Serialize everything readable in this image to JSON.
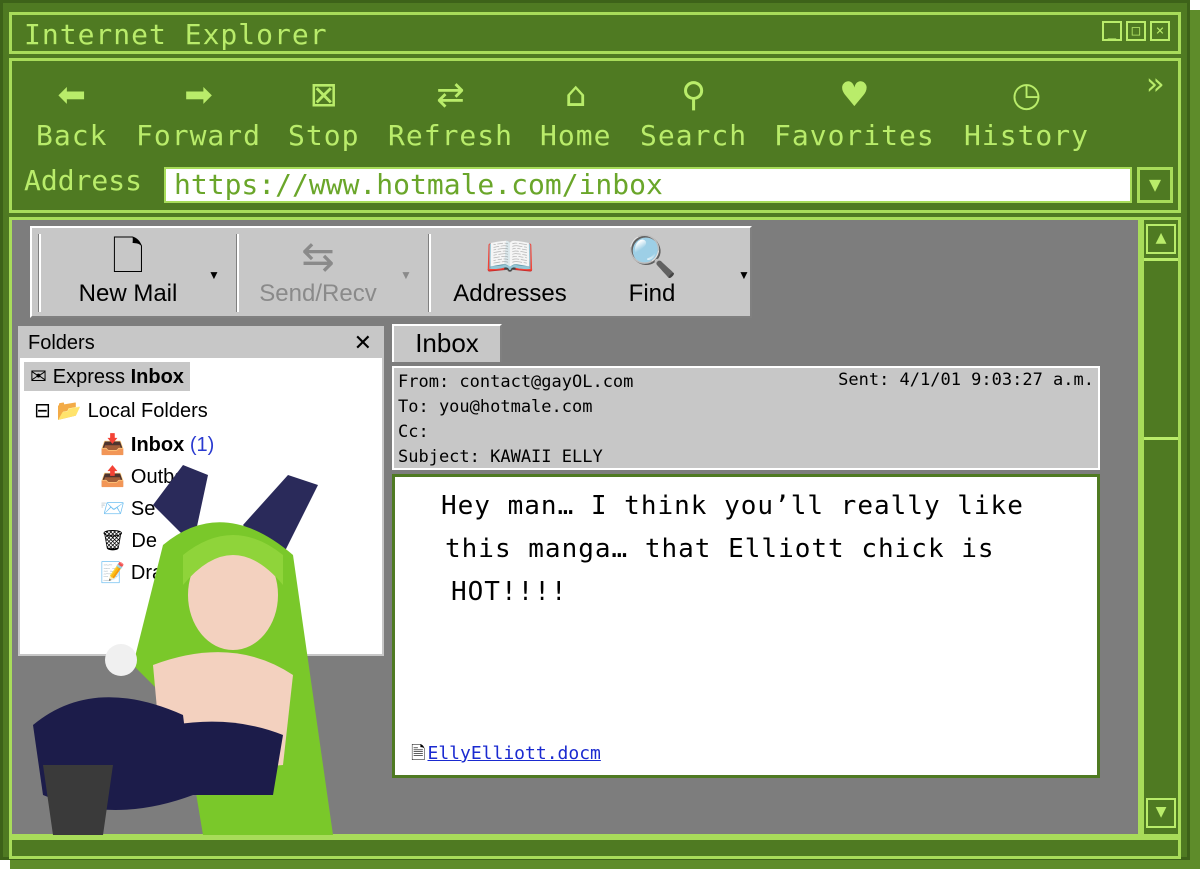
{
  "window": {
    "title": "Internet Explorer"
  },
  "toolbar": {
    "buttons": [
      {
        "label": "Back",
        "icon": "back-arrow-icon"
      },
      {
        "label": "Forward",
        "icon": "forward-arrow-icon"
      },
      {
        "label": "Stop",
        "icon": "stop-icon"
      },
      {
        "label": "Refresh",
        "icon": "refresh-icon"
      },
      {
        "label": "Home",
        "icon": "home-icon"
      },
      {
        "label": "Search",
        "icon": "search-icon"
      },
      {
        "label": "Favorites",
        "icon": "heart-icon"
      },
      {
        "label": "History",
        "icon": "history-icon"
      }
    ],
    "more": "»"
  },
  "address": {
    "label": "Address",
    "value": "https://www.hotmale.com/inbox"
  },
  "outlook": {
    "toolbar": {
      "new_mail": "New Mail",
      "send_recv": "Send/Recv",
      "addresses": "Addresses",
      "find": "Find"
    },
    "folders": {
      "header": "Folders",
      "root_prefix": "Express",
      "root_bold": "Inbox",
      "local": "Local Folders",
      "inbox": "Inbox",
      "inbox_count": "(1)",
      "outbox": "Outbo",
      "sent": "Se",
      "deleted": "De",
      "drafts": "Draft"
    },
    "tab": "Inbox",
    "message": {
      "from": "From: contact@gayOL.com",
      "sent": "Sent: 4/1/01 9:03:27 a.m.",
      "to": "To: you@hotmale.com",
      "cc": "Cc:",
      "subject": "Subject: KAWAII ELLY",
      "body_line1": "Hey man… I think you’ll really like",
      "body_line2": "this manga… that Elliott chick is",
      "body_line3": "HOT!!!!",
      "attachment": "EllyElliott.docm"
    }
  },
  "colors": {
    "frame": "#4f7a22",
    "accent": "#b9ec6a",
    "pane": "#7d7d7d",
    "chrome": "#c7c7c7"
  }
}
